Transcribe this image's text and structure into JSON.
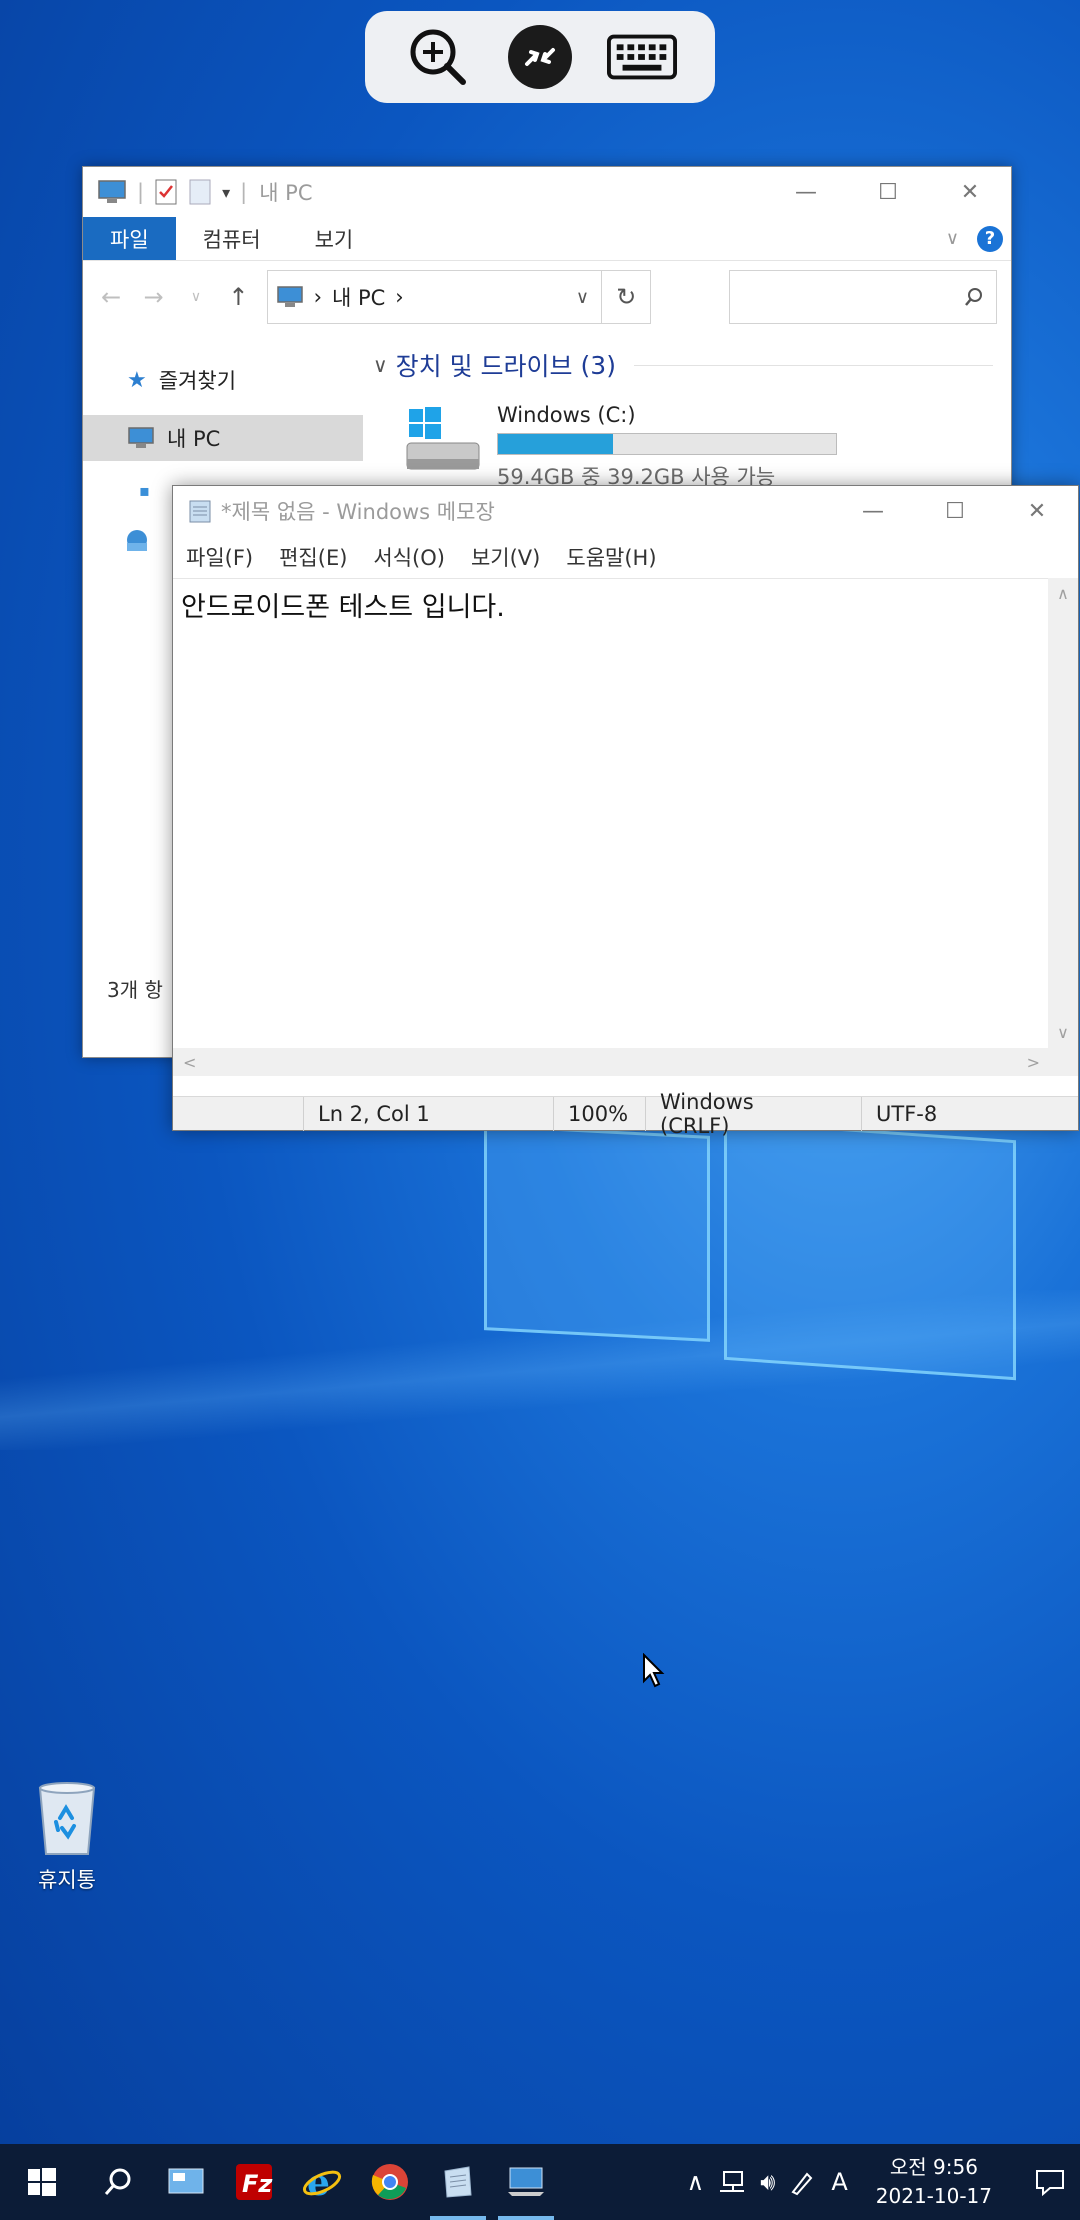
{
  "remote_toolbar": {
    "icons": [
      "zoom-in-icon",
      "remote-connection-icon",
      "keyboard-icon"
    ]
  },
  "explorer": {
    "title": "내 PC",
    "tabs": {
      "file": "파일",
      "computer": "컴퓨터",
      "view": "보기"
    },
    "address": {
      "path_item": "내 PC",
      "separator": "›"
    },
    "search_placeholder": "",
    "nav": {
      "favorites": "즐겨찾기",
      "this_pc": "내 PC"
    },
    "group": {
      "label": "장치 및 드라이브",
      "count": "(3)"
    },
    "drive": {
      "name": "Windows (C:)",
      "free_text": "59.4GB 중 39.2GB 사용 가능",
      "used_fraction": 0.34
    },
    "status": "3개 항"
  },
  "notepad": {
    "title": "*제목 없음 - Windows 메모장",
    "menu": {
      "file": "파일(F)",
      "edit": "편집(E)",
      "format": "서식(O)",
      "view": "보기(V)",
      "help": "도움말(H)"
    },
    "text": "안드로이드폰 테스트 입니다.",
    "status": {
      "position": "Ln 2, Col 1",
      "zoom": "100%",
      "line_ending": "Windows (CRLF)",
      "encoding": "UTF-8"
    }
  },
  "desktop": {
    "recycle_bin": "휴지통"
  },
  "taskbar": {
    "time": "오전 9:56",
    "date": "2021-10-17",
    "ime": "A",
    "colors": {
      "background": "#0c1c37",
      "accent": "#76b9ed"
    }
  }
}
